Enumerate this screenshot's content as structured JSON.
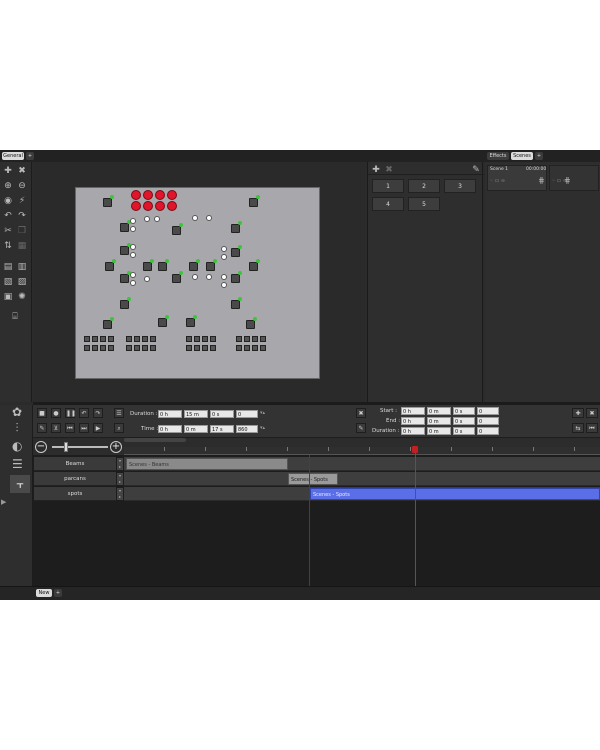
{
  "tabs": {
    "general": "General",
    "add": "+",
    "effects": "Effects",
    "scenes": "Scenes",
    "add_right": "+"
  },
  "scene_pad": {
    "buttons": [
      "1",
      "2",
      "3",
      "4",
      "5"
    ]
  },
  "scene_list": {
    "item_name": "Scene 1",
    "item_time": "00:00:00"
  },
  "timing": {
    "duration_label": "Duration :",
    "duration": [
      "0 h",
      "15 m",
      "0 s",
      "0"
    ],
    "time_label": "Time :",
    "time": [
      "0 h",
      "0 m",
      "17 s",
      "860"
    ]
  },
  "range": {
    "start_label": "Start :",
    "start": [
      "0 h",
      "0 m",
      "0 s",
      "0"
    ],
    "end_label": "End :",
    "end": [
      "0 h",
      "0 m",
      "0 s",
      "0"
    ],
    "duration_label": "Duration :",
    "duration": [
      "0 h",
      "0 m",
      "0 s",
      "0"
    ]
  },
  "tracks": [
    {
      "name": "Beams",
      "clip": "Scenes - Beams"
    },
    {
      "name": "parcans",
      "clip": "Scenes - Spots"
    },
    {
      "name": "spots",
      "clip": "Scenes - Spots"
    }
  ],
  "bottom": {
    "new_tab": "New",
    "add": "+"
  },
  "colors": {
    "clip_blue": "#5a6ee8",
    "playhead": "#d02020",
    "fixture_led": "#3cc43c",
    "red_fixture": "#e0142a"
  }
}
